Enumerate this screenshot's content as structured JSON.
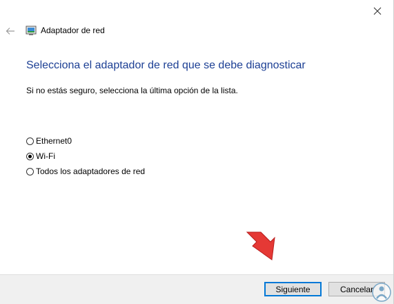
{
  "window": {
    "title": "Adaptador de red"
  },
  "main": {
    "heading": "Selecciona el adaptador de red que se debe diagnosticar",
    "instruction": "Si no estás seguro, selecciona la última opción de la lista."
  },
  "options": [
    {
      "label": "Ethernet0",
      "selected": false
    },
    {
      "label": "Wi-Fi",
      "selected": true
    },
    {
      "label": "Todos los adaptadores de red",
      "selected": false
    }
  ],
  "footer": {
    "next_label": "Siguiente",
    "cancel_label": "Cancelar"
  },
  "colors": {
    "heading": "#1c3f94",
    "focus_border": "#0078d7",
    "footer_bg": "#f0f0f0",
    "arrow": "#e53935"
  },
  "icons": {
    "close": "close-icon",
    "back": "back-arrow-icon",
    "app": "network-adapter-icon"
  }
}
